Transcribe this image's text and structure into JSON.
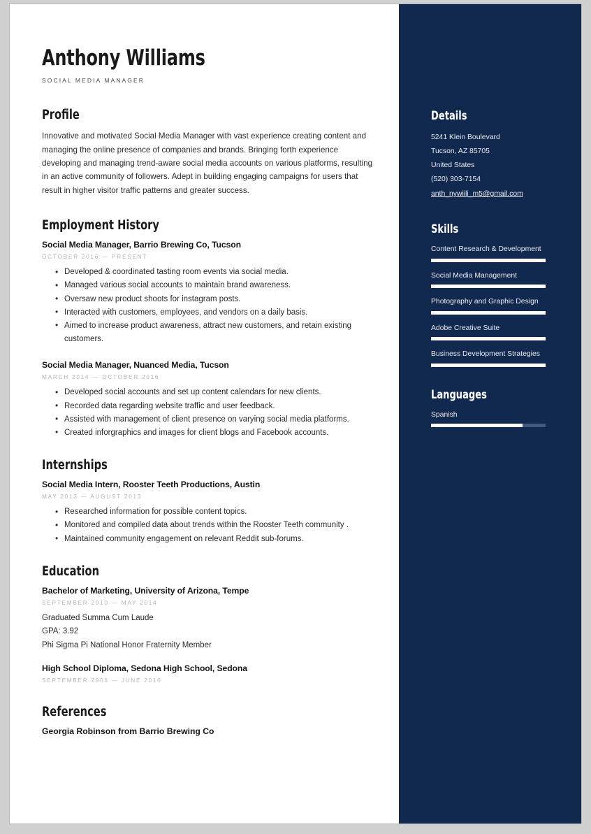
{
  "colors": {
    "sidebar_bg": "#12294f",
    "bar_fill": "#ffffff",
    "bar_track": "#41597d",
    "page_bg": "#ffffff",
    "text": "#2b2b2b",
    "muted_date": "#b4b4b4"
  },
  "header": {
    "name": "Anthony Williams",
    "subtitle": "SOCIAL MEDIA MANAGER"
  },
  "profile": {
    "title": "Profile",
    "text": "Innovative and motivated Social Media Manager with vast experience creating content and managing the online presence of companies and brands. Bringing forth experience developing and managing trend-aware social media accounts on various platforms, resulting in an active community of followers. Adept in building engaging campaigns for users that result in higher visitor traffic patterns and greater success."
  },
  "employment": {
    "title": "Employment History",
    "entries": [
      {
        "title": "Social Media Manager, Barrio Brewing Co, Tucson",
        "dates": "OCTOBER 2016 — PRESENT",
        "bullets": [
          "Developed & coordinated tasting room events via social media.",
          "Managed various social accounts to maintain brand awareness.",
          "Oversaw new product shoots for instagram posts.",
          "Interacted with customers, employees, and vendors on a daily basis.",
          "Aimed to increase product awareness, attract new customers, and retain existing customers."
        ]
      },
      {
        "title": "Social Media Manager, Nuanced Media, Tucson",
        "dates": "MARCH 2014 — OCTOBER 2016",
        "bullets": [
          "Developed social accounts and set up content calendars for new clients.",
          "Recorded data regarding website traffic and user feedback.",
          "Assisted with management of client presence on varying social media platforms.",
          "Created inforgraphics and images for client blogs and Facebook accounts."
        ]
      }
    ]
  },
  "internships": {
    "title": "Internships",
    "entries": [
      {
        "title": "Social Media Intern, Rooster Teeth Productions, Austin",
        "dates": "MAY 2013 — AUGUST 2013",
        "bullets": [
          "Researched information for possible content topics.",
          "Monitored and compiled data about trends within the Rooster Teeth community .",
          "Maintained community engagement on relevant Reddit sub-forums."
        ]
      }
    ]
  },
  "education": {
    "title": "Education",
    "entries": [
      {
        "title": "Bachelor of Marketing, University of Arizona, Tempe",
        "dates": "SEPTEMBER 2010 — MAY 2014",
        "lines": [
          "Graduated Summa Cum Laude",
          "GPA: 3.92",
          "Phi Sigma Pi National Honor Fraternity Member"
        ]
      },
      {
        "title": "High School Diploma, Sedona High School, Sedona",
        "dates": "SEPTEMBER 2006 — JUNE 2010",
        "lines": []
      }
    ]
  },
  "references": {
    "title": "References",
    "entries": [
      {
        "name": "Georgia Robinson from Barrio Brewing Co"
      }
    ]
  },
  "details": {
    "title": "Details",
    "address_line1": "5241 Klein Boulevard",
    "address_line2": "Tucson, AZ 85705",
    "country": "United States",
    "phone": "(520) 303-7154",
    "email": "anth_nywiili_m5@gmail.com"
  },
  "skills": {
    "title": "Skills",
    "items": [
      {
        "label": "Content Research & Development",
        "level": 100
      },
      {
        "label": "Social Media Management",
        "level": 100
      },
      {
        "label": "Photography and Graphic Design",
        "level": 100
      },
      {
        "label": "Adobe Creative Suite",
        "level": 100
      },
      {
        "label": "Business Development Strategies",
        "level": 100
      }
    ]
  },
  "languages": {
    "title": "Languages",
    "items": [
      {
        "label": "Spanish",
        "level": 80
      }
    ]
  }
}
